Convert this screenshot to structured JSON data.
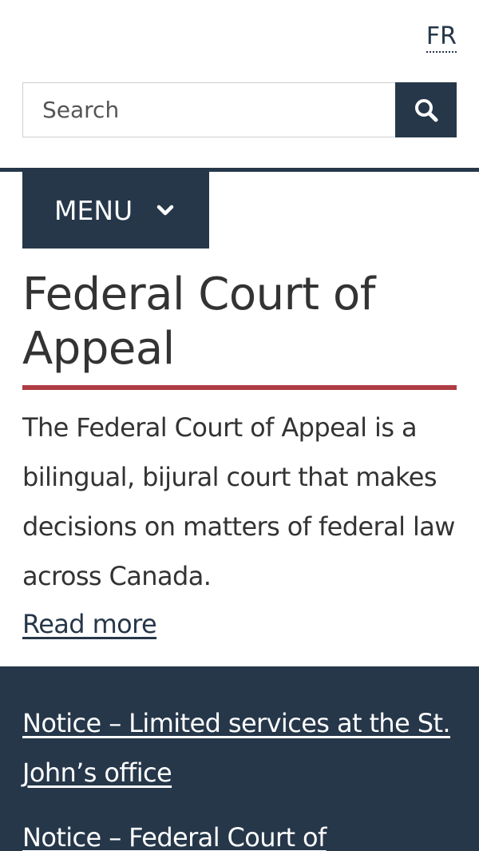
{
  "header": {
    "language_toggle": "FR",
    "search": {
      "placeholder": "Search",
      "value": "",
      "button_icon": "search-icon"
    },
    "menu": {
      "label": "MENU",
      "icon": "chevron-down-icon"
    }
  },
  "main": {
    "title": "Federal Court of Appeal",
    "intro": "The Federal Court of Appeal is a bilingual, bijural court that makes decisions on matters of federal law across Canada.",
    "read_more": "Read more"
  },
  "notices": [
    {
      "label": "Notice – Limited services at the St. John’s office"
    },
    {
      "label": "Notice – Federal Court of"
    }
  ],
  "colors": {
    "brand_navy": "#26374a",
    "accent_red": "#af3c43",
    "text": "#333333"
  }
}
